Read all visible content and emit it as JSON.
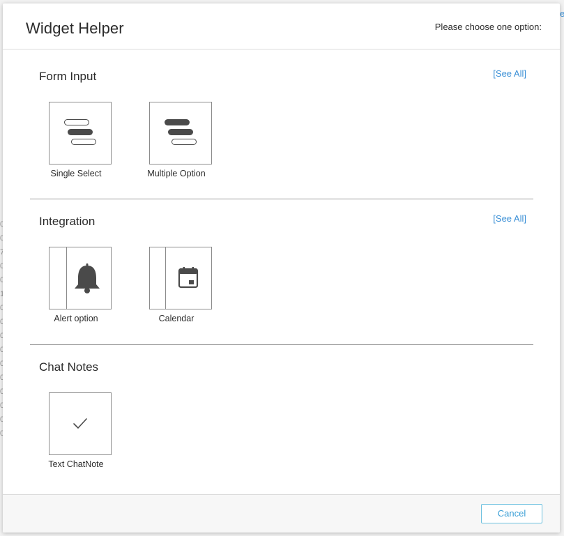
{
  "background": {
    "left_column_chars": [
      "0",
      "0",
      "7",
      "0",
      "0",
      "1",
      "0",
      "0",
      "0",
      "0",
      "0",
      "0",
      "0",
      "0",
      "0",
      "0"
    ],
    "right_link_fragment": "e"
  },
  "modal": {
    "title": "Widget Helper",
    "hint": "Please choose one option:",
    "sections": [
      {
        "title": "Form Input",
        "see_all": "[See All]",
        "tiles": [
          {
            "label": "Single Select",
            "icon": "single-select-icon"
          },
          {
            "label": "Multiple Option",
            "icon": "multiple-option-icon"
          }
        ]
      },
      {
        "title": "Integration",
        "see_all": "[See All]",
        "tiles": [
          {
            "label": "Alert option",
            "icon": "bell-icon"
          },
          {
            "label": "Calendar",
            "icon": "calendar-icon"
          }
        ]
      },
      {
        "title": "Chat Notes",
        "tiles": [
          {
            "label": "Text ChatNote",
            "icon": "checkmark-icon"
          }
        ]
      }
    ],
    "footer": {
      "cancel_label": "Cancel"
    }
  },
  "colors": {
    "accent": "#3a8fd6",
    "cancel_border": "#6cc0df",
    "icon": "#4a4a4a",
    "divider": "#9a9a9a"
  }
}
